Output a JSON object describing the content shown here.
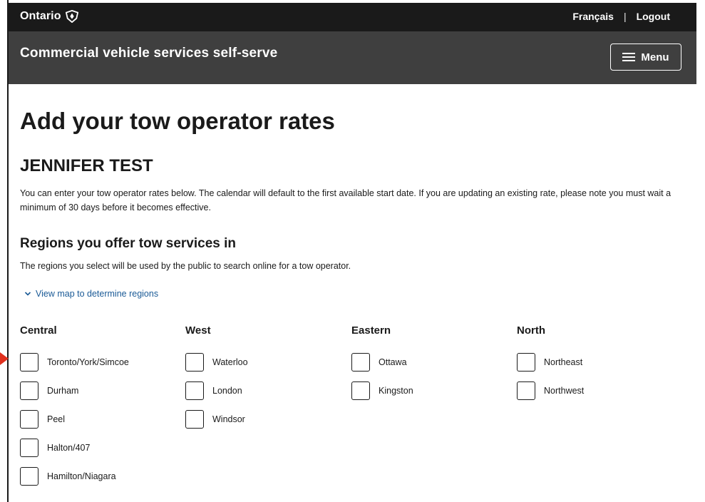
{
  "header": {
    "brand": "Ontario",
    "links": [
      "Français",
      "Logout"
    ],
    "separator": "|"
  },
  "subheader": {
    "title": "Commercial vehicle services self-serve",
    "menu_label": "Menu"
  },
  "main": {
    "title": "Add your tow operator rates",
    "applicant": "JENNIFER TEST",
    "intro": "You can enter your tow operator rates below. The calendar will default to the first available start date. If you are updating an existing rate, please note you must wait a minimum of 30 days before it becomes effective.",
    "regions_heading": "Regions you offer tow services in",
    "regions_desc": "The regions you select will be used by the public to search online for a tow operator.",
    "map_link": "View map to determine regions",
    "columns": [
      {
        "title": "Central",
        "options": [
          "Toronto/York/Simcoe",
          "Durham",
          "Peel",
          "Halton/407",
          "Hamilton/Niagara"
        ]
      },
      {
        "title": "West",
        "options": [
          "Waterloo",
          "London",
          "Windsor"
        ]
      },
      {
        "title": "Eastern",
        "options": [
          "Ottawa",
          "Kingston"
        ]
      },
      {
        "title": "North",
        "options": [
          "Northeast",
          "Northwest"
        ]
      }
    ]
  },
  "colors": {
    "topbar": "#1a1a1a",
    "subheader": "#3f3f3f",
    "link": "#1a5a96",
    "pointer": "#e0301e"
  },
  "icons": {
    "brand_mark": "ontario-trillium-icon",
    "menu": "hamburger-icon",
    "map_link": "chevron-down-icon",
    "pointer": "red-arrow-pointer-icon"
  }
}
